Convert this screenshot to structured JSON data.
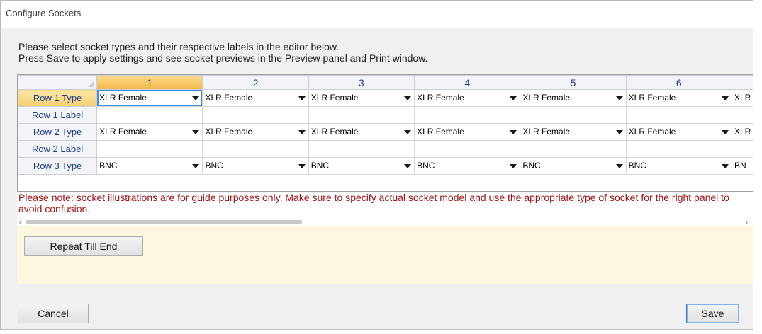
{
  "window": {
    "title": "Configure Sockets"
  },
  "instructions": {
    "line1": "Please select socket types and their respective labels in the editor below.",
    "line2": "Press Save to apply settings and see socket previews in the Preview panel and Print window."
  },
  "grid": {
    "columns": [
      "1",
      "2",
      "3",
      "4",
      "5",
      "6",
      ""
    ],
    "rows": [
      {
        "header": "Row 1 Type",
        "kind": "select",
        "values": [
          "XLR Female",
          "XLR Female",
          "XLR Female",
          "XLR Female",
          "XLR Female",
          "XLR Female",
          "XLR"
        ]
      },
      {
        "header": "Row 1 Label",
        "kind": "text",
        "values": [
          "",
          "",
          "",
          "",
          "",
          "",
          ""
        ]
      },
      {
        "header": "Row 2 Type",
        "kind": "select",
        "values": [
          "XLR Female",
          "XLR Female",
          "XLR Female",
          "XLR Female",
          "XLR Female",
          "XLR Female",
          "XLR"
        ]
      },
      {
        "header": "Row 2 Label",
        "kind": "text",
        "values": [
          "",
          "",
          "",
          "",
          "",
          "",
          ""
        ]
      },
      {
        "header": "Row 3 Type",
        "kind": "select",
        "values": [
          "BNC",
          "BNC",
          "BNC",
          "BNC",
          "BNC",
          "BNC",
          "BN"
        ]
      }
    ]
  },
  "note": "Please note: socket illustrations are for guide purposes only. Make sure to specify actual socket model and use the appropriate type of socket for the right panel to avoid confusion.",
  "buttons": {
    "repeat": "Repeat Till End",
    "cancel": "Cancel",
    "save": "Save"
  },
  "colors": {
    "note": "#a31515",
    "header_text": "#1a3a8a",
    "active_column": "#f2b846",
    "repeat_area": "#fdf7df"
  }
}
